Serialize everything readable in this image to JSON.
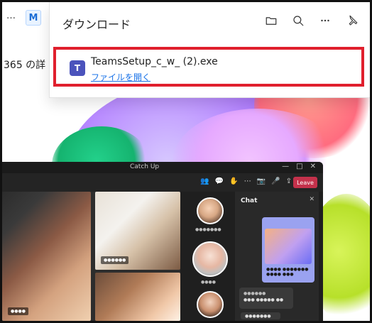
{
  "app": {
    "dots": "…",
    "app_icon_label": "M",
    "background_text": "365 の詳"
  },
  "downloads_panel": {
    "title": "ダウンロード",
    "actions": [
      {
        "name": "folder",
        "icon": "folder-icon"
      },
      {
        "name": "search",
        "icon": "search-icon"
      },
      {
        "name": "more",
        "icon": "more-icon"
      },
      {
        "name": "pin",
        "icon": "pin-icon"
      }
    ],
    "items": [
      {
        "filename": "TeamsSetup_c_w_ (2).exe",
        "action_label": "ファイルを開く",
        "icon": "teams-icon"
      }
    ]
  },
  "teams_preview": {
    "window_title": "Catch Up",
    "leave_label": "Leave",
    "chat_title": "Chat"
  },
  "colors": {
    "highlight": "#e01f2d",
    "link": "#1a73e8",
    "teams_purple": "#4b53bc"
  }
}
